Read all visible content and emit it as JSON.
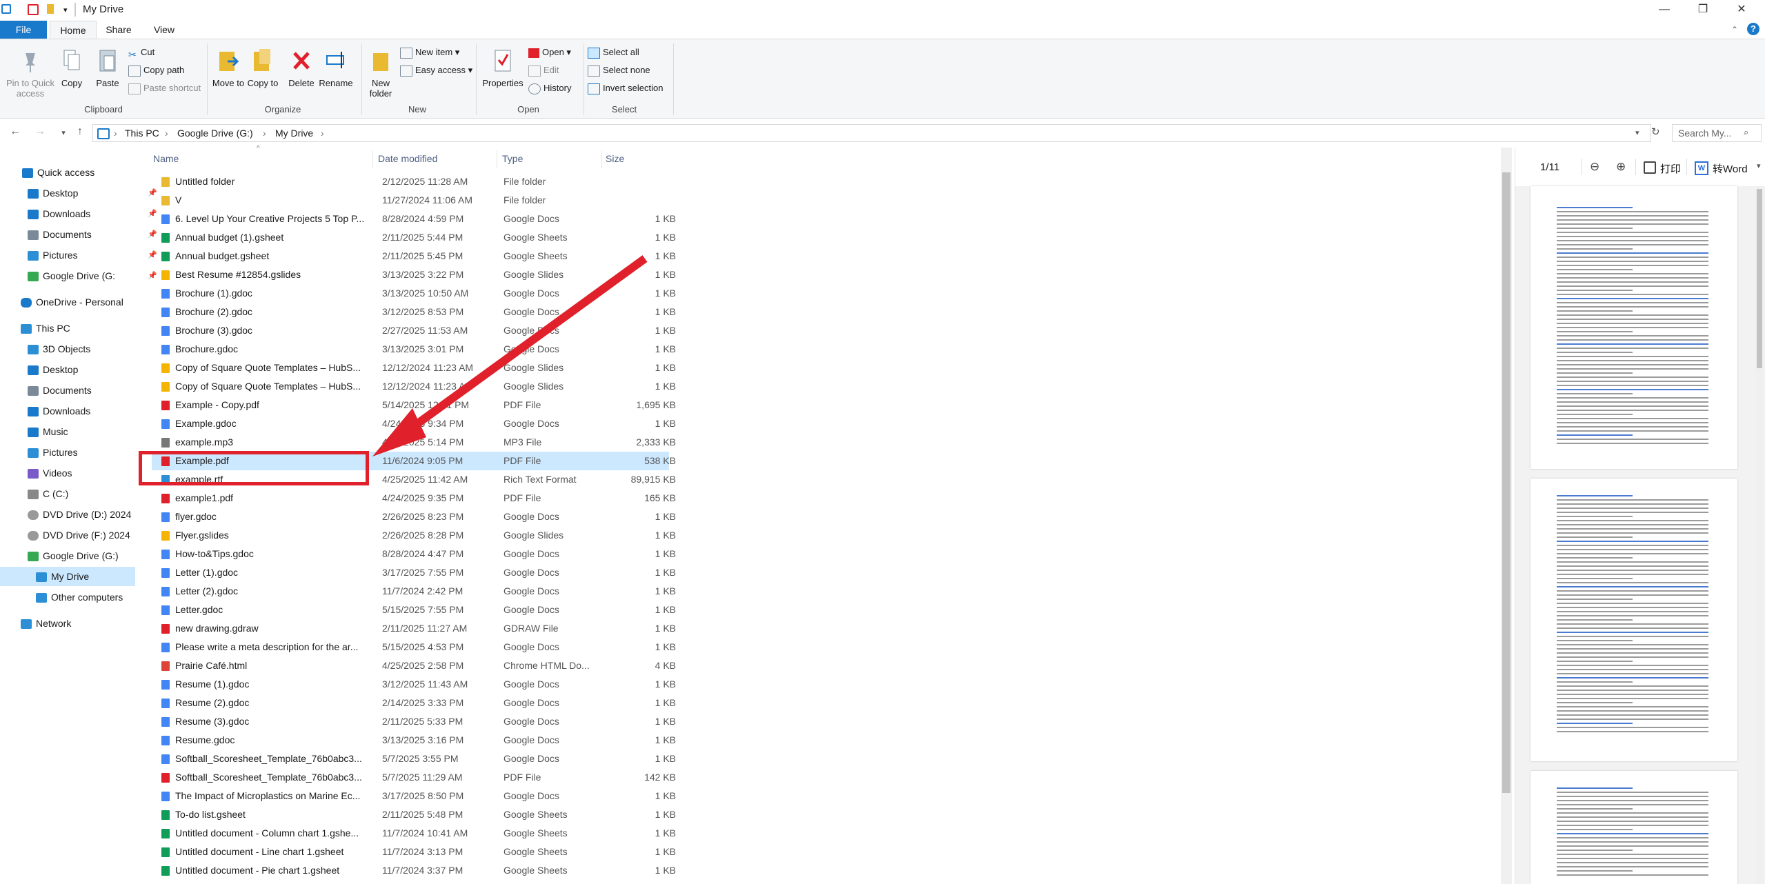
{
  "window": {
    "title": "My Drive"
  },
  "ribbon_tabs": {
    "file": "File",
    "home": "Home",
    "share": "Share",
    "view": "View"
  },
  "ribbon": {
    "clipboard": {
      "label": "Clipboard",
      "pin": "Pin to Quick access",
      "copy": "Copy",
      "paste": "Paste",
      "cut": "Cut",
      "copy_path": "Copy path",
      "paste_shortcut": "Paste shortcut"
    },
    "organize": {
      "label": "Organize",
      "move_to": "Move to",
      "copy_to": "Copy to",
      "delete": "Delete",
      "rename": "Rename"
    },
    "new": {
      "label": "New",
      "new_folder": "New folder",
      "new_item": "New item",
      "easy_access": "Easy access"
    },
    "open": {
      "label": "Open",
      "properties": "Properties",
      "open": "Open",
      "edit": "Edit",
      "history": "History"
    },
    "select": {
      "label": "Select",
      "select_all": "Select all",
      "select_none": "Select none",
      "invert": "Invert selection"
    }
  },
  "address": {
    "crumbs": [
      "This PC",
      "Google Drive (G:)",
      "My Drive"
    ],
    "search_placeholder": "Search My..."
  },
  "sidebar": {
    "items": [
      {
        "label": "Quick access",
        "color": "#1979ca"
      },
      {
        "label": "Desktop",
        "color": "#1979ca",
        "pinned": true
      },
      {
        "label": "Downloads",
        "color": "#1979ca",
        "pinned": true
      },
      {
        "label": "Documents",
        "color": "#7a8a99",
        "pinned": true
      },
      {
        "label": "Pictures",
        "color": "#2c8fd6",
        "pinned": true
      },
      {
        "label": "Google Drive (G:",
        "color": "#34a853",
        "pinned": true
      },
      {
        "label": "OneDrive - Personal",
        "color": "#1979ca"
      },
      {
        "label": "This PC",
        "color": "#2c8fd6"
      },
      {
        "label": "3D Objects",
        "color": "#2c8fd6"
      },
      {
        "label": "Desktop",
        "color": "#1979ca"
      },
      {
        "label": "Documents",
        "color": "#7a8a99"
      },
      {
        "label": "Downloads",
        "color": "#1979ca"
      },
      {
        "label": "Music",
        "color": "#1979ca"
      },
      {
        "label": "Pictures",
        "color": "#2c8fd6"
      },
      {
        "label": "Videos",
        "color": "#7a5ac9"
      },
      {
        "label": "C (C:)",
        "color": "#888888"
      },
      {
        "label": "DVD Drive (D:) 2024",
        "color": "#999999"
      },
      {
        "label": "DVD Drive (F:) 2024",
        "color": "#999999"
      },
      {
        "label": "Google Drive (G:)",
        "color": "#34a853"
      },
      {
        "label": "My Drive",
        "color": "#2c8fd6"
      },
      {
        "label": "Other computers",
        "color": "#2c8fd6"
      },
      {
        "label": "Network",
        "color": "#2c8fd6"
      }
    ]
  },
  "columns": {
    "name": "Name",
    "date": "Date modified",
    "type": "Type",
    "size": "Size"
  },
  "files": [
    {
      "name": "Untitled folder",
      "date": "2/12/2025 11:28 AM",
      "type": "File folder",
      "size": "",
      "color": "#e8b931"
    },
    {
      "name": "V",
      "date": "11/27/2024 11:06 AM",
      "type": "File folder",
      "size": "",
      "color": "#e8b931"
    },
    {
      "name": "6. Level Up Your Creative Projects 5 Top P...",
      "date": "8/28/2024 4:59 PM",
      "type": "Google Docs",
      "size": "1 KB",
      "color": "#4285f4"
    },
    {
      "name": "Annual budget (1).gsheet",
      "date": "2/11/2025 5:44 PM",
      "type": "Google Sheets",
      "size": "1 KB",
      "color": "#0f9d58"
    },
    {
      "name": "Annual budget.gsheet",
      "date": "2/11/2025 5:45 PM",
      "type": "Google Sheets",
      "size": "1 KB",
      "color": "#0f9d58"
    },
    {
      "name": "Best Resume #12854.gslides",
      "date": "3/13/2025 3:22 PM",
      "type": "Google Slides",
      "size": "1 KB",
      "color": "#f4b400"
    },
    {
      "name": "Brochure (1).gdoc",
      "date": "3/13/2025 10:50 AM",
      "type": "Google Docs",
      "size": "1 KB",
      "color": "#4285f4"
    },
    {
      "name": "Brochure (2).gdoc",
      "date": "3/12/2025 8:53 PM",
      "type": "Google Docs",
      "size": "1 KB",
      "color": "#4285f4"
    },
    {
      "name": "Brochure (3).gdoc",
      "date": "2/27/2025 11:53 AM",
      "type": "Google Docs",
      "size": "1 KB",
      "color": "#4285f4"
    },
    {
      "name": "Brochure.gdoc",
      "date": "3/13/2025 3:01 PM",
      "type": "Google Docs",
      "size": "1 KB",
      "color": "#4285f4"
    },
    {
      "name": "Copy of Square Quote Templates – HubS...",
      "date": "12/12/2024 11:23 AM",
      "type": "Google Slides",
      "size": "1 KB",
      "color": "#f4b400"
    },
    {
      "name": "Copy of Square Quote Templates – HubS...",
      "date": "12/12/2024 11:23 AM",
      "type": "Google Slides",
      "size": "1 KB",
      "color": "#f4b400"
    },
    {
      "name": "Example - Copy.pdf",
      "date": "5/14/2025 12:51 PM",
      "type": "PDF File",
      "size": "1,695 KB",
      "color": "#e0202a"
    },
    {
      "name": "Example.gdoc",
      "date": "4/24/2025 9:34 PM",
      "type": "Google Docs",
      "size": "1 KB",
      "color": "#4285f4"
    },
    {
      "name": "example.mp3",
      "date": "4/24/2025 5:14 PM",
      "type": "MP3 File",
      "size": "2,333 KB",
      "color": "#777777"
    },
    {
      "name": "Example.pdf",
      "date": "11/6/2024 9:05 PM",
      "type": "PDF File",
      "size": "538 KB",
      "color": "#e0202a",
      "selected": true
    },
    {
      "name": "example.rtf",
      "date": "4/25/2025 11:42 AM",
      "type": "Rich Text Format",
      "size": "89,915 KB",
      "color": "#2c8fd6"
    },
    {
      "name": "example1.pdf",
      "date": "4/24/2025 9:35 PM",
      "type": "PDF File",
      "size": "165 KB",
      "color": "#e0202a"
    },
    {
      "name": "flyer.gdoc",
      "date": "2/26/2025 8:23 PM",
      "type": "Google Docs",
      "size": "1 KB",
      "color": "#4285f4"
    },
    {
      "name": "Flyer.gslides",
      "date": "2/26/2025 8:28 PM",
      "type": "Google Slides",
      "size": "1 KB",
      "color": "#f4b400"
    },
    {
      "name": "How-to&Tips.gdoc",
      "date": "8/28/2024 4:47 PM",
      "type": "Google Docs",
      "size": "1 KB",
      "color": "#4285f4"
    },
    {
      "name": "Letter (1).gdoc",
      "date": "3/17/2025 7:55 PM",
      "type": "Google Docs",
      "size": "1 KB",
      "color": "#4285f4"
    },
    {
      "name": "Letter (2).gdoc",
      "date": "11/7/2024 2:42 PM",
      "type": "Google Docs",
      "size": "1 KB",
      "color": "#4285f4"
    },
    {
      "name": "Letter.gdoc",
      "date": "5/15/2025 7:55 PM",
      "type": "Google Docs",
      "size": "1 KB",
      "color": "#4285f4"
    },
    {
      "name": "new drawing.gdraw",
      "date": "2/11/2025 11:27 AM",
      "type": "GDRAW File",
      "size": "1 KB",
      "color": "#e0202a"
    },
    {
      "name": "Please write a meta description for the ar...",
      "date": "5/15/2025 4:53 PM",
      "type": "Google Docs",
      "size": "1 KB",
      "color": "#4285f4"
    },
    {
      "name": "Prairie Café.html",
      "date": "4/25/2025 2:58 PM",
      "type": "Chrome HTML Do...",
      "size": "4 KB",
      "color": "#db4437"
    },
    {
      "name": "Resume (1).gdoc",
      "date": "3/12/2025 11:43 AM",
      "type": "Google Docs",
      "size": "1 KB",
      "color": "#4285f4"
    },
    {
      "name": "Resume (2).gdoc",
      "date": "2/14/2025 3:33 PM",
      "type": "Google Docs",
      "size": "1 KB",
      "color": "#4285f4"
    },
    {
      "name": "Resume (3).gdoc",
      "date": "2/11/2025 5:33 PM",
      "type": "Google Docs",
      "size": "1 KB",
      "color": "#4285f4"
    },
    {
      "name": "Resume.gdoc",
      "date": "3/13/2025 3:16 PM",
      "type": "Google Docs",
      "size": "1 KB",
      "color": "#4285f4"
    },
    {
      "name": "Softball_Scoresheet_Template_76b0abc3...",
      "date": "5/7/2025 3:55 PM",
      "type": "Google Docs",
      "size": "1 KB",
      "color": "#4285f4"
    },
    {
      "name": "Softball_Scoresheet_Template_76b0abc3...",
      "date": "5/7/2025 11:29 AM",
      "type": "PDF File",
      "size": "142 KB",
      "color": "#e0202a"
    },
    {
      "name": "The Impact of Microplastics on Marine Ec...",
      "date": "3/17/2025 8:50 PM",
      "type": "Google Docs",
      "size": "1 KB",
      "color": "#4285f4"
    },
    {
      "name": "To-do list.gsheet",
      "date": "2/11/2025 5:48 PM",
      "type": "Google Sheets",
      "size": "1 KB",
      "color": "#0f9d58"
    },
    {
      "name": "Untitled document - Column chart 1.gshe...",
      "date": "11/7/2024 10:41 AM",
      "type": "Google Sheets",
      "size": "1 KB",
      "color": "#0f9d58"
    },
    {
      "name": "Untitled document - Line chart 1.gsheet",
      "date": "11/7/2024 3:13 PM",
      "type": "Google Sheets",
      "size": "1 KB",
      "color": "#0f9d58"
    },
    {
      "name": "Untitled document - Pie chart 1.gsheet",
      "date": "11/7/2024 3:37 PM",
      "type": "Google Sheets",
      "size": "1 KB",
      "color": "#0f9d58"
    }
  ],
  "preview": {
    "page_indicator": "1/11",
    "print": "打印",
    "to_word": "转Word"
  },
  "annotation_color": "#e0202a"
}
